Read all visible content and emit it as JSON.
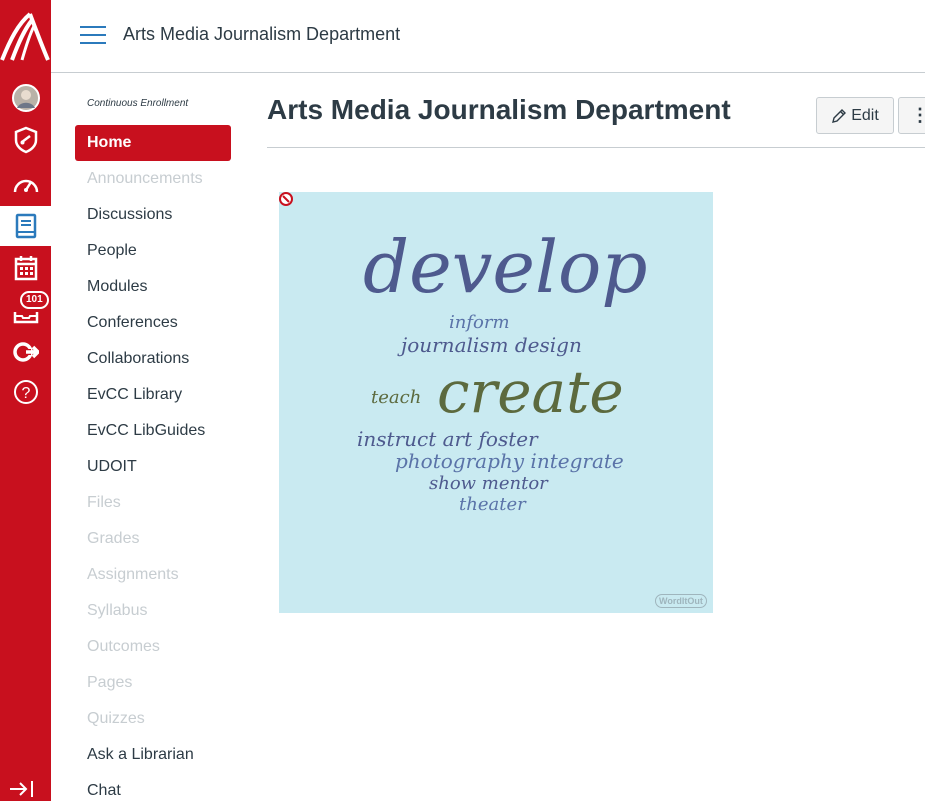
{
  "global_nav": {
    "logo": "college-logo",
    "items": [
      {
        "name": "account-avatar"
      },
      {
        "name": "admin-shield-icon"
      },
      {
        "name": "dashboard-icon"
      },
      {
        "name": "courses-icon"
      },
      {
        "name": "calendar-icon"
      },
      {
        "name": "inbox-icon",
        "badge": "101"
      },
      {
        "name": "commons-icon"
      },
      {
        "name": "help-icon"
      }
    ],
    "accent": "#c8101e"
  },
  "header": {
    "title": "Arts Media Journalism Department"
  },
  "course_nav": {
    "enrollment": "Continuous Enrollment",
    "items": [
      {
        "label": "Home",
        "state": "active"
      },
      {
        "label": "Announcements",
        "state": "disabled"
      },
      {
        "label": "Discussions",
        "state": "normal"
      },
      {
        "label": "People",
        "state": "normal"
      },
      {
        "label": "Modules",
        "state": "normal"
      },
      {
        "label": "Conferences",
        "state": "normal"
      },
      {
        "label": "Collaborations",
        "state": "normal"
      },
      {
        "label": "EvCC Library",
        "state": "normal"
      },
      {
        "label": "EvCC LibGuides",
        "state": "normal"
      },
      {
        "label": "UDOIT",
        "state": "normal"
      },
      {
        "label": "Files",
        "state": "disabled"
      },
      {
        "label": "Grades",
        "state": "disabled"
      },
      {
        "label": "Assignments",
        "state": "disabled"
      },
      {
        "label": "Syllabus",
        "state": "disabled"
      },
      {
        "label": "Outcomes",
        "state": "disabled"
      },
      {
        "label": "Pages",
        "state": "disabled"
      },
      {
        "label": "Quizzes",
        "state": "disabled"
      },
      {
        "label": "Ask a Librarian",
        "state": "normal"
      },
      {
        "label": "Chat",
        "state": "normal"
      }
    ]
  },
  "main": {
    "page_title": "Arts Media Journalism Department",
    "edit_label": "Edit",
    "more_label": "⋮"
  },
  "word_cloud": {
    "background": "#c9eaf1",
    "words": {
      "develop": "develop",
      "inform": "inform",
      "journalism_design": "journalism design",
      "teach": "teach",
      "create": "create",
      "instruct_art_foster": "instruct art foster",
      "photography_integrate": "photography integrate",
      "show_mentor": "show mentor",
      "theater": "theater"
    },
    "watermark": "WordItOut"
  }
}
